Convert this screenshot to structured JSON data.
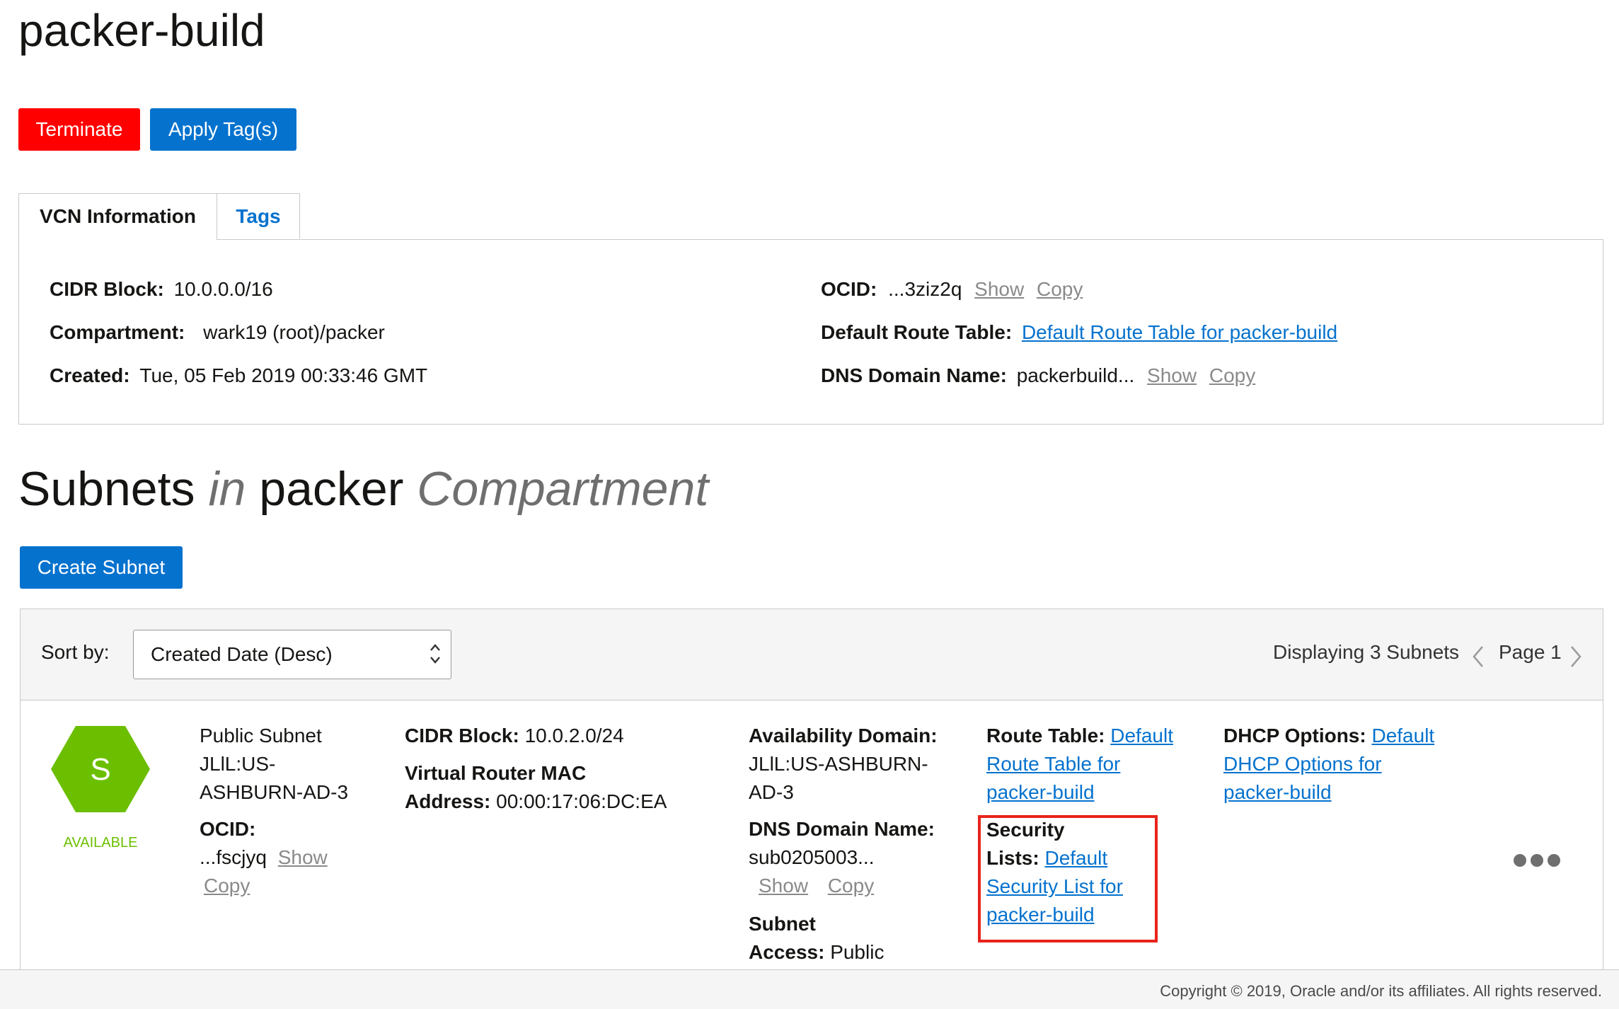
{
  "page": {
    "title": "packer-build"
  },
  "actions": {
    "terminate": "Terminate",
    "apply_tags": "Apply Tag(s)"
  },
  "tabs": [
    {
      "label": "VCN Information",
      "active": true
    },
    {
      "label": "Tags",
      "active": false
    }
  ],
  "vcn_info": {
    "cidr_label": "CIDR Block:",
    "cidr_value": "10.0.0.0/16",
    "compartment_label": "Compartment:",
    "compartment_value": "wark19 (root)/packer",
    "created_label": "Created:",
    "created_value": "Tue, 05 Feb 2019 00:33:46 GMT",
    "ocid_label": "OCID:",
    "ocid_value": "...3ziz2q",
    "show": "Show",
    "copy": "Copy",
    "route_label": "Default Route Table:",
    "route_value": "Default Route Table for packer-build",
    "dns_label": "DNS Domain Name:",
    "dns_value": "packerbuild..."
  },
  "subnets_section": {
    "title_a": "Subnets",
    "title_in": "in",
    "title_b": "packer",
    "title_c": "Compartment",
    "create_button": "Create Subnet",
    "sort_label": "Sort by:",
    "sort_value": "Created Date (Desc)",
    "displaying": "Displaying 3 Subnets",
    "page_label": "Page 1"
  },
  "subnet": {
    "icon_letter": "S",
    "status": "AVAILABLE",
    "name": [
      "Public Subnet",
      "JLlL:US-",
      "ASHBURN-AD-3"
    ],
    "ocid_label": "OCID:",
    "ocid_value": "...fscjyq",
    "show": "Show",
    "copy": "Copy",
    "cidr_label": "CIDR Block:",
    "cidr_value": "10.0.2.0/24",
    "mac_label_1": "Virtual Router MAC",
    "mac_label_2": "Address:",
    "mac_value": "00:00:17:06:DC:EA",
    "ad_label": "Availability Domain:",
    "ad_value_1": "JLlL:US-ASHBURN-",
    "ad_value_2": "AD-3",
    "dns_label": "DNS Domain Name:",
    "dns_value": "sub0205003...",
    "access_label_1": "Subnet",
    "access_label_2": "Access:",
    "access_value": "Public",
    "route_label": "Route Table:",
    "route_link": [
      "Default",
      "Route Table for",
      "packer-build"
    ],
    "security_label_1": "Security",
    "security_label_2": "Lists:",
    "security_link": [
      "Default",
      "Security List for",
      "packer-build"
    ],
    "dhcp_label": "DHCP Options:",
    "dhcp_link": [
      "Default",
      "DHCP Options for",
      "packer-build"
    ]
  },
  "footer": {
    "copyright": "Copyright © 2019, Oracle and/or its affiliates. All rights reserved."
  },
  "colors": {
    "accent": "#0572ce",
    "danger": "#ff0000",
    "status_green": "#6bbf00",
    "highlight_red": "#e8231b"
  }
}
